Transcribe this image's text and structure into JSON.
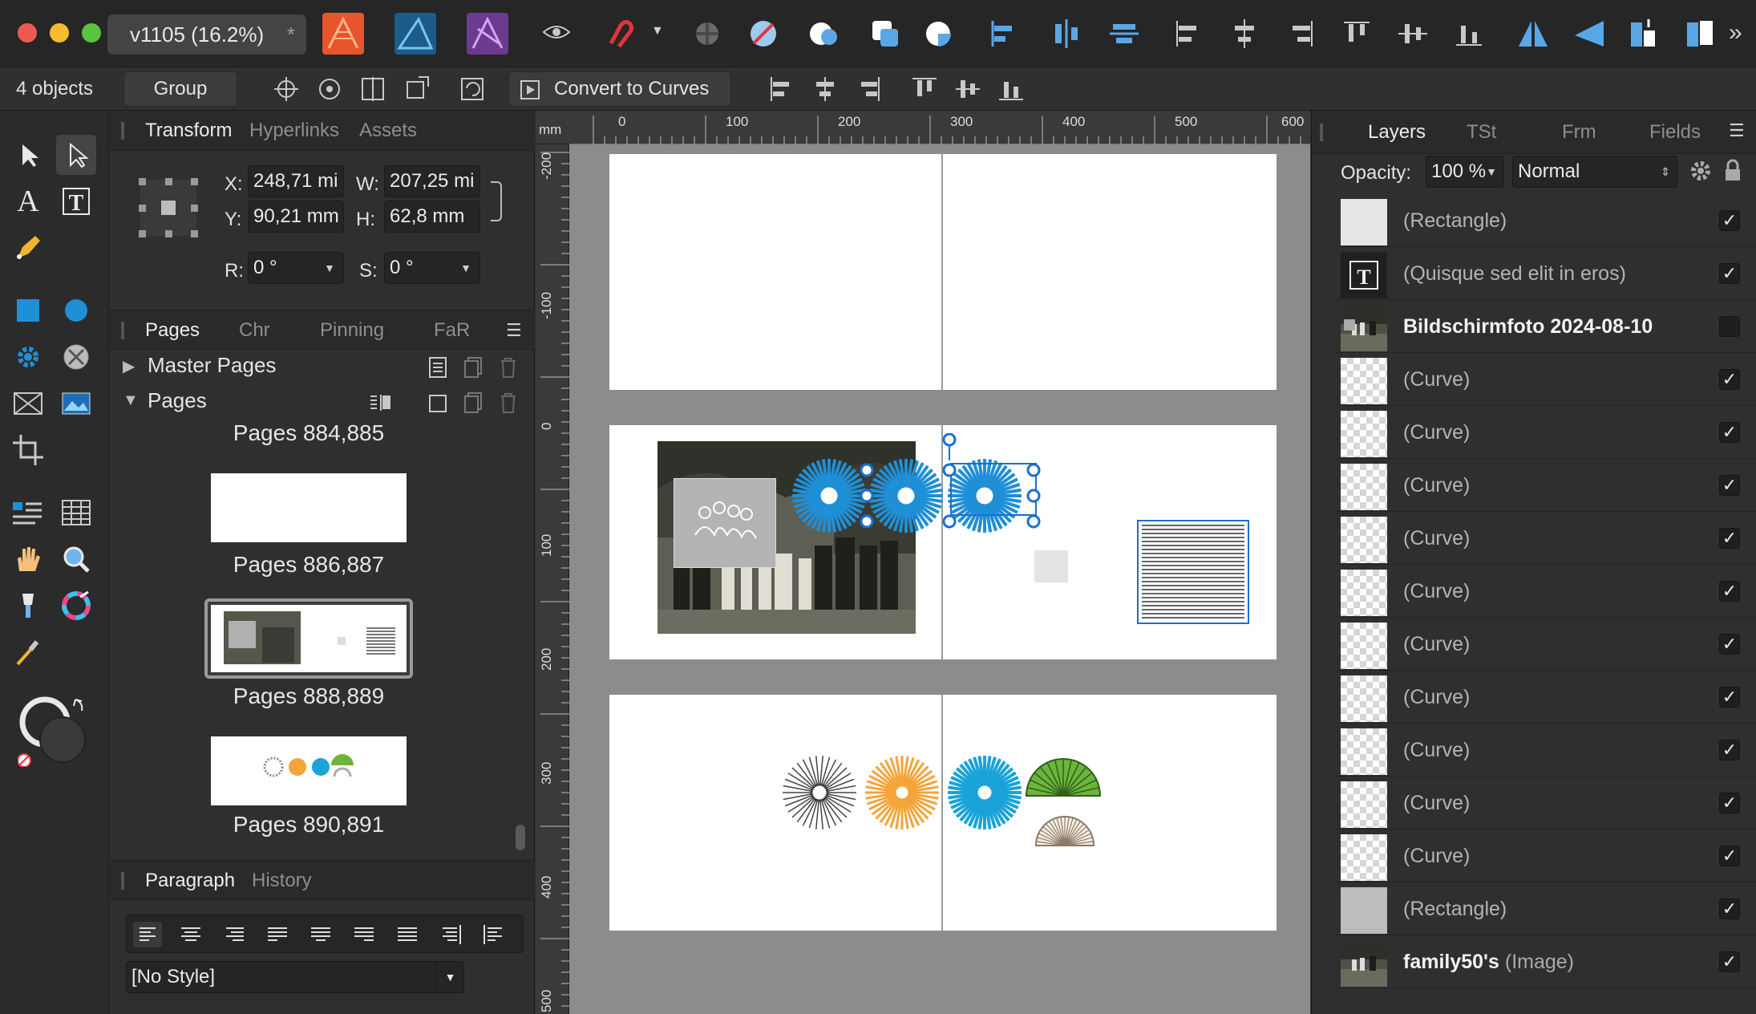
{
  "window": {
    "doc_tab": "v1105  (16.2%)",
    "doc_tab_close": "*"
  },
  "context": {
    "selection_count": "4 objects",
    "group_label": "Group",
    "convert_label": "Convert to Curves"
  },
  "transform": {
    "tabs": [
      "Transform",
      "Hyperlinks",
      "Assets"
    ],
    "x_label": "X:",
    "x_value": "248,71 mi",
    "y_label": "Y:",
    "y_value": "90,21 mm",
    "w_label": "W:",
    "w_value": "207,25 mi",
    "h_label": "H:",
    "h_value": "62,8 mm",
    "r_label": "R:",
    "r_value": "0 °",
    "s_label": "S:",
    "s_value": "0 °"
  },
  "pages": {
    "tabs": [
      "Pages",
      "Chr",
      "Pinning",
      "FaR"
    ],
    "master_pages": "Master Pages",
    "pages_section": "Pages",
    "spreads": [
      "Pages 884,885",
      "Pages 886,887",
      "Pages 888,889",
      "Pages 890,891"
    ],
    "selected_spread": "Pages 888,889"
  },
  "paragraph": {
    "tabs": [
      "Paragraph",
      "History"
    ],
    "style_value": "[No Style]"
  },
  "rulers": {
    "unit": "mm",
    "top": [
      "0",
      "100",
      "200",
      "300",
      "400",
      "500",
      "600"
    ],
    "left": [
      "-200",
      "-100",
      "0",
      "100",
      "200",
      "300",
      "400",
      "500"
    ]
  },
  "layers": {
    "tabs": [
      "Layers",
      "TSt",
      "Frm",
      "Fields"
    ],
    "opacity_label": "Opacity:",
    "opacity_value": "100 %",
    "blend_mode": "Normal",
    "items": [
      {
        "name": "(Rectangle)",
        "kind": "",
        "bold": false,
        "checked": true,
        "thumb": "rect-light"
      },
      {
        "name": "(Quisque sed elit in eros)",
        "kind": "",
        "bold": false,
        "checked": true,
        "thumb": "text"
      },
      {
        "name": "Bildschirmfoto 2024-08-10",
        "kind": "",
        "bold": true,
        "checked": false,
        "thumb": "photo"
      },
      {
        "name": "(Curve)",
        "kind": "",
        "bold": false,
        "checked": true,
        "thumb": "checker"
      },
      {
        "name": "(Curve)",
        "kind": "",
        "bold": false,
        "checked": true,
        "thumb": "checker"
      },
      {
        "name": "(Curve)",
        "kind": "",
        "bold": false,
        "checked": true,
        "thumb": "checker"
      },
      {
        "name": "(Curve)",
        "kind": "",
        "bold": false,
        "checked": true,
        "thumb": "checker"
      },
      {
        "name": "(Curve)",
        "kind": "",
        "bold": false,
        "checked": true,
        "thumb": "checker"
      },
      {
        "name": "(Curve)",
        "kind": "",
        "bold": false,
        "checked": true,
        "thumb": "checker"
      },
      {
        "name": "(Curve)",
        "kind": "",
        "bold": false,
        "checked": true,
        "thumb": "checker"
      },
      {
        "name": "(Curve)",
        "kind": "",
        "bold": false,
        "checked": true,
        "thumb": "checker"
      },
      {
        "name": "(Curve)",
        "kind": "",
        "bold": false,
        "checked": true,
        "thumb": "checker"
      },
      {
        "name": "(Curve)",
        "kind": "",
        "bold": false,
        "checked": true,
        "thumb": "checker"
      },
      {
        "name": "(Rectangle)",
        "kind": "",
        "bold": false,
        "checked": true,
        "thumb": "rect-grey"
      },
      {
        "name": "family50's",
        "kind": "(Image)",
        "bold": true,
        "checked": true,
        "thumb": "photo2"
      }
    ]
  },
  "colors": {
    "accent_blue": "#1f8fd6",
    "handle_blue": "#1b6fd0",
    "sunburst_orange": "#f3a43a",
    "sunburst_blue": "#19a3d8",
    "fan_green": "#6cb43c"
  }
}
